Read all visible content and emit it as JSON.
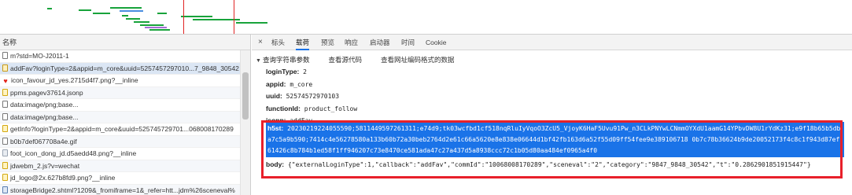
{
  "left_pane": {
    "header": "名称",
    "rows": [
      {
        "icon": "document-icon",
        "text": "m?std=MO-J2011-1"
      },
      {
        "icon": "xhr-icon",
        "text": "addFav?loginType=2&appid=m_core&uuid=5257457297010...7_9848_30542"
      },
      {
        "icon": "heart-icon",
        "text": "icon_favour_jd_yes.2715d4f7.png?__inline"
      },
      {
        "icon": "script-icon",
        "text": "ppms.pagev37614.jsonp"
      },
      {
        "icon": "document-icon",
        "text": "data:image/png;base..."
      },
      {
        "icon": "document-icon",
        "text": "data:image/png;base..."
      },
      {
        "icon": "script-icon",
        "text": "getInfo?loginType=2&appid=m_core&uuid=525745729701...068008170289"
      },
      {
        "icon": "document-icon",
        "text": "b0b7def067708a4e.gif"
      },
      {
        "icon": "image-icon",
        "text": "foot_icon_dong_jd.d5aedd48.png?__inline"
      },
      {
        "icon": "script-icon",
        "text": "jdwebm_2.js?v=wechat"
      },
      {
        "icon": "script-icon",
        "text": "jd_logo@2x.627b8fd9.png?__inline"
      },
      {
        "icon": "xhr-icon",
        "text": "storageBridge2.shtml?1209&_fromiframe=1&_refer=htt...jdm%26sceneval%"
      }
    ]
  },
  "tabs": {
    "close": "×",
    "items": [
      "标头",
      "载荷",
      "预览",
      "响应",
      "启动器",
      "时间",
      "Cookie"
    ],
    "active_index": 1
  },
  "query_section": {
    "arrow": "▼",
    "title": "查询字符串参数",
    "link_source": "查看源代码",
    "link_decoded": "查看网址编码格式的数据"
  },
  "params": [
    {
      "key": "loginType:",
      "value": "2"
    },
    {
      "key": "appid:",
      "value": "m_core"
    },
    {
      "key": "uuid:",
      "value": "52574572970103"
    },
    {
      "key": "functionId:",
      "value": "product_follow"
    },
    {
      "key": "jsonp:",
      "value": "addFav"
    }
  ],
  "h5st": {
    "key": "h5st:",
    "value": "20230219224055590;5811449597261311;e74d9;tk03wcfbd1cf518nqRluIyVqoO3ZcU5_VjoyK6HaF5Uvu91Pw_n3CLkPNYwLCNmmOYXdU1aamG14YPbvDW8U1rYdKz31;e9f18b65b5dba7c5a9b590;7414c4e56278580a133b60b72a30beb2764d2e61c66a5620e8e838e06644d1bf42fb163d6a52f55d09ff54fee9e389106718 0b7c78b36624b9de20052173f4c8c1f943d87ef61426c8b784b1ed58f1ff946207c73e8470ce581ada47c27a437d5a8938ccc72c1b05d80aa484ef0965a4f0"
  },
  "body": {
    "key": "body:",
    "value": "{\"externalLoginType\":1,\"callback\":\"addFav\",\"commId\":\"10068008170289\",\"sceneval\":\"2\",\"category\":\"9847_9848_30542\",\"t\":\"0.2862901851915447\"}"
  },
  "colors": {
    "accent": "#1a73e8",
    "highlight_box": "#e8202a",
    "timeline_red": "#e02424",
    "timeline_green": "#18a33b"
  }
}
